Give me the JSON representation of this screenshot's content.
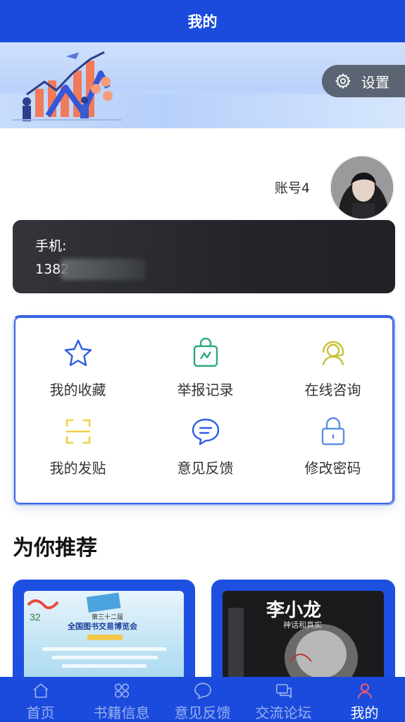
{
  "header": {
    "title": "我的"
  },
  "settings": {
    "icon": "gear-icon",
    "label": "设置"
  },
  "profile": {
    "account_name": "账号4",
    "phone_label": "手机:",
    "phone_value_visible": "1382"
  },
  "menu": {
    "items": [
      {
        "label": "我的收藏",
        "icon": "star-icon",
        "color": "#2b5ce6"
      },
      {
        "label": "举报记录",
        "icon": "shopping-bag-icon",
        "color": "#2aa882"
      },
      {
        "label": "在线咨询",
        "icon": "headset-icon",
        "color": "#c8c23b"
      },
      {
        "label": "我的发贴",
        "icon": "scan-icon",
        "color": "#f0d140"
      },
      {
        "label": "意见反馈",
        "icon": "chat-bubble-icon",
        "color": "#2b5ce6"
      },
      {
        "label": "修改密码",
        "icon": "lock-icon",
        "color": "#5b8fe8"
      }
    ]
  },
  "recommend": {
    "title": "为你推荐",
    "books": [
      {
        "title_line1": "第三十二届",
        "title_line2": "全国图书交易博览会"
      },
      {
        "title": "李小龙",
        "subtitle": "神话和真实"
      }
    ]
  },
  "tabbar": {
    "items": [
      {
        "label": "首页",
        "icon": "home-icon"
      },
      {
        "label": "书籍信息",
        "icon": "grid-icon"
      },
      {
        "label": "意见反馈",
        "icon": "chat-bubble-icon"
      },
      {
        "label": "交流论坛",
        "icon": "forum-icon"
      },
      {
        "label": "我的",
        "icon": "user-icon",
        "active": true
      }
    ]
  },
  "colors": {
    "primary": "#1a4bdc",
    "card_dark": "#2a2c32",
    "settings_bg": "#5b6472"
  }
}
